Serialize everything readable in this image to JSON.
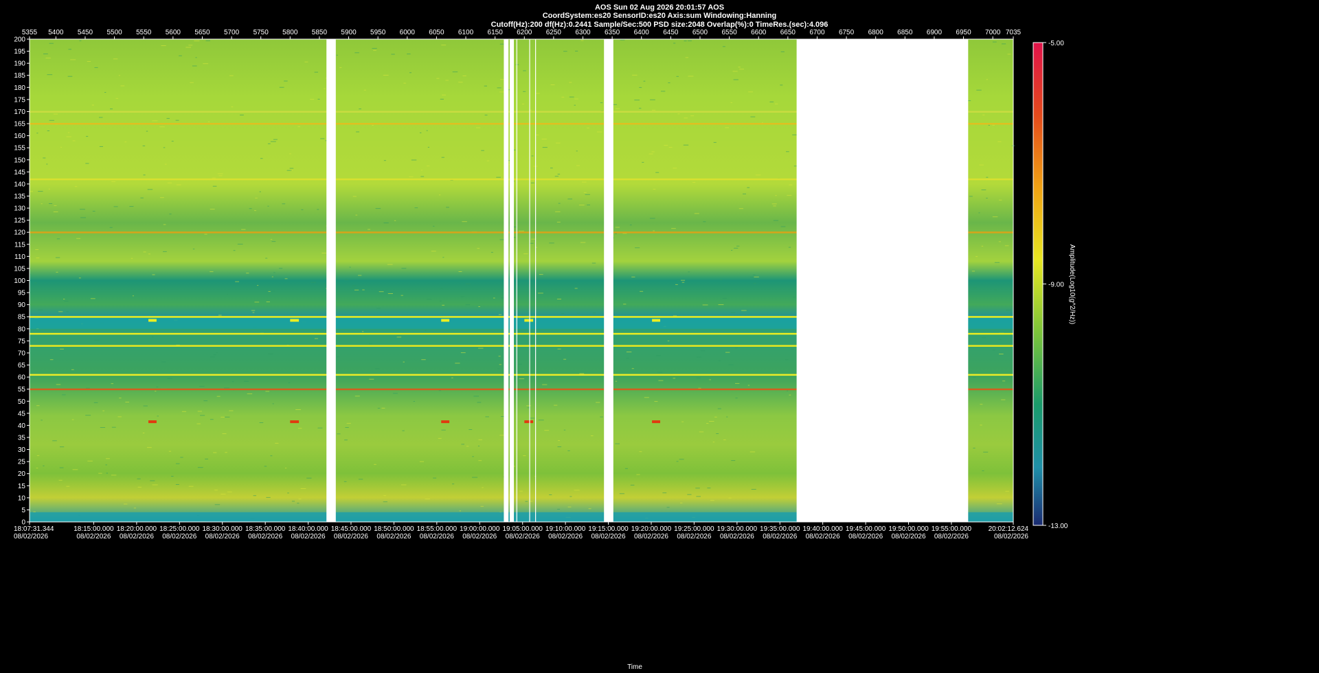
{
  "header": {
    "line1": "AOS  Sun 02 Aug 2026 20:01:57  AOS",
    "line2": "CoordSystem:es20   SensorID:es20    Axis:sum    Windowing:Hanning",
    "line3": "Cutoff(Hz):200      df(Hz):0.2441      Sample/Sec:500      PSD size:2048      Overlap(%):0       TimeRes.(sec):4.096"
  },
  "chart_data": {
    "type": "heatmap",
    "title": "AOS  Sun 02 Aug 2026 20:01:57  AOS",
    "top_axis": {
      "range": [
        5355,
        7035
      ],
      "ticks": [
        5355,
        5400,
        5450,
        5500,
        5550,
        5600,
        5650,
        5700,
        5750,
        5800,
        5850,
        5900,
        5950,
        6000,
        6050,
        6100,
        6150,
        6200,
        6250,
        6300,
        6350,
        6400,
        6450,
        6500,
        6550,
        6600,
        6650,
        6700,
        6750,
        6800,
        6850,
        6900,
        6950,
        7000,
        7035
      ]
    },
    "y_axis": {
      "label": "",
      "range": [
        0,
        200
      ],
      "ticks": [
        0,
        5,
        10,
        15,
        20,
        25,
        30,
        35,
        40,
        45,
        50,
        55,
        60,
        65,
        70,
        75,
        80,
        85,
        90,
        95,
        100,
        105,
        110,
        115,
        120,
        125,
        130,
        135,
        140,
        145,
        150,
        155,
        160,
        165,
        170,
        175,
        180,
        185,
        190,
        195,
        200
      ]
    },
    "x_axis": {
      "label": "Time",
      "start": "18:07:31.344",
      "end": "20:02:12.624",
      "ticks": [
        {
          "t": "18:07:31.344",
          "date": "08/02/2026",
          "idx": 5355
        },
        {
          "t": "18:15:00.000",
          "date": "08/02/2026",
          "idx": 5464.6
        },
        {
          "t": "18:20:00.000",
          "date": "08/02/2026",
          "idx": 5537.9
        },
        {
          "t": "18:25:00.000",
          "date": "08/02/2026",
          "idx": 5611.1
        },
        {
          "t": "18:30:00.000",
          "date": "08/02/2026",
          "idx": 5684.3
        },
        {
          "t": "18:35:00.000",
          "date": "08/02/2026",
          "idx": 5757.6
        },
        {
          "t": "18:40:00.000",
          "date": "08/02/2026",
          "idx": 5830.8
        },
        {
          "t": "18:45:00.000",
          "date": "08/02/2026",
          "idx": 5904.0
        },
        {
          "t": "18:50:00.000",
          "date": "08/02/2026",
          "idx": 5977.3
        },
        {
          "t": "18:55:00.000",
          "date": "08/02/2026",
          "idx": 6050.5
        },
        {
          "t": "19:00:00.000",
          "date": "08/02/2026",
          "idx": 6123.7
        },
        {
          "t": "19:05:00.000",
          "date": "08/02/2026",
          "idx": 6197.0
        },
        {
          "t": "19:10:00.000",
          "date": "08/02/2026",
          "idx": 6270.2
        },
        {
          "t": "19:15:00.000",
          "date": "08/02/2026",
          "idx": 6343.4
        },
        {
          "t": "19:20:00.000",
          "date": "08/02/2026",
          "idx": 6416.7
        },
        {
          "t": "19:25:00.000",
          "date": "08/02/2026",
          "idx": 6489.9
        },
        {
          "t": "19:30:00.000",
          "date": "08/02/2026",
          "idx": 6563.2
        },
        {
          "t": "19:35:00.000",
          "date": "08/02/2026",
          "idx": 6636.4
        },
        {
          "t": "19:40:00.000",
          "date": "08/02/2026",
          "idx": 6709.6
        },
        {
          "t": "19:45:00.000",
          "date": "08/02/2026",
          "idx": 6782.9
        },
        {
          "t": "19:50:00.000",
          "date": "08/02/2026",
          "idx": 6856.1
        },
        {
          "t": "19:55:00.000",
          "date": "08/02/2026",
          "idx": 6929.3
        },
        {
          "t": "20:02:12.624",
          "date": "08/02/2026",
          "idx": 7035
        }
      ]
    },
    "colorbar": {
      "label": "Amplitude(Log10(g^2/Hz))",
      "min": -13.0,
      "max": -5.0,
      "ticks": [
        "-5.00",
        "-9.00",
        "-13.00"
      ]
    },
    "data_gaps": [
      [
        5862,
        5878
      ],
      [
        6165,
        6173
      ],
      [
        6175,
        6182
      ],
      [
        6336,
        6352
      ],
      [
        6665,
        6958
      ]
    ],
    "thin_gaps": [
      6187,
      6209,
      6219
    ],
    "tonal_lines_hz": [
      {
        "hz": 120,
        "color": "#d6a51a"
      },
      {
        "hz": 85,
        "color": "#ecee20"
      },
      {
        "hz": 78,
        "color": "#ecee20"
      },
      {
        "hz": 73,
        "color": "#e8e820"
      },
      {
        "hz": 61,
        "color": "#ecec28"
      },
      {
        "hz": 55,
        "color": "#d06020"
      },
      {
        "hz": 165,
        "color": "#e0c020"
      },
      {
        "hz": 142,
        "color": "#d8e030"
      },
      {
        "hz": 170,
        "color": "#c8dc40"
      }
    ],
    "brands": [
      {
        "from_hz": 80,
        "to_hz": 85,
        "color": "#1aa3a0"
      },
      {
        "from_hz": 0,
        "to_hz": 4,
        "color": "#1f9fa8"
      }
    ],
    "events": [
      {
        "idx_from": 5558,
        "idx_to": 5572,
        "hz": 41.5,
        "color": "#e03a10"
      },
      {
        "idx_from": 5800,
        "idx_to": 5815,
        "hz": 41.5,
        "color": "#e03a10"
      },
      {
        "idx_from": 6058,
        "idx_to": 6072,
        "hz": 41.5,
        "color": "#e03a10"
      },
      {
        "idx_from": 6200,
        "idx_to": 6215,
        "hz": 41.5,
        "color": "#e03a10"
      },
      {
        "idx_from": 6418,
        "idx_to": 6432,
        "hz": 41.5,
        "color": "#e03a10"
      },
      {
        "idx_from": 5558,
        "idx_to": 5572,
        "hz": 83.5,
        "color": "#ecee20"
      },
      {
        "idx_from": 5800,
        "idx_to": 5815,
        "hz": 83.5,
        "color": "#ecee20"
      },
      {
        "idx_from": 6058,
        "idx_to": 6072,
        "hz": 83.5,
        "color": "#ecee20"
      },
      {
        "idx_from": 6200,
        "idx_to": 6215,
        "hz": 83.5,
        "color": "#ecee20"
      },
      {
        "idx_from": 6418,
        "idx_to": 6432,
        "hz": 83.5,
        "color": "#ecee20"
      }
    ],
    "grid": false,
    "colors": {
      "background": "#000000",
      "gap": "#ffffff",
      "low": "#1f9f8a",
      "mid": "#7ec83c",
      "high": "#d6e23a"
    }
  }
}
